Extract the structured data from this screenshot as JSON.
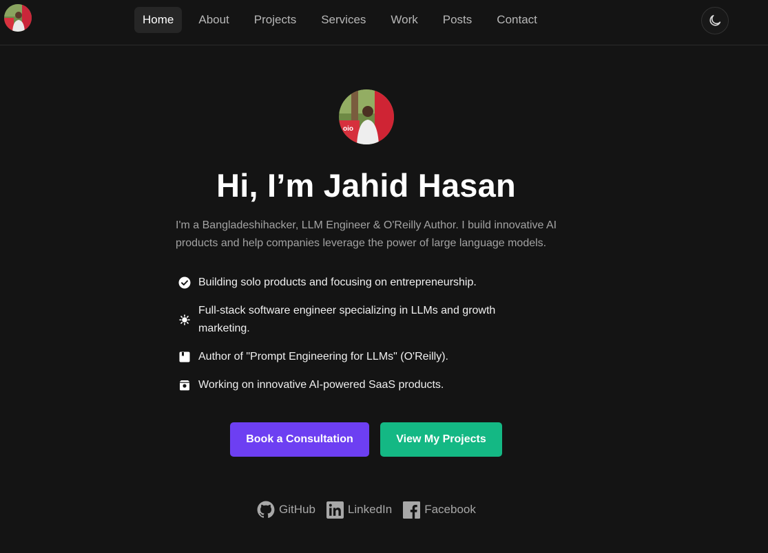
{
  "nav": {
    "items": [
      {
        "label": "Home",
        "active": true
      },
      {
        "label": "About"
      },
      {
        "label": "Projects"
      },
      {
        "label": "Services"
      },
      {
        "label": "Work"
      },
      {
        "label": "Posts"
      },
      {
        "label": "Contact"
      }
    ],
    "theme_toggle_icon": "moon-icon"
  },
  "hero": {
    "title": "Hi, I’m Jahid Hasan",
    "intro": "I'm a Bangladeshihacker, LLM Engineer & O'Reilly Author. I build innovative AI products and help companies leverage the power of large language models.",
    "highlights": [
      {
        "icon": "check-circle-icon",
        "text": "Building solo products and focusing on entrepreneurship."
      },
      {
        "icon": "sun-icon",
        "text": "Full-stack software engineer specializing in LLMs and growth marketing."
      },
      {
        "icon": "book-icon",
        "text": "Author of \"Prompt Engineering for LLMs\" (O'Reilly)."
      },
      {
        "icon": "product-box-icon",
        "text": "Working on innovative AI-powered SaaS products."
      }
    ],
    "primary_button": "Book a Consultation",
    "secondary_button": "View My Projects"
  },
  "socials": [
    {
      "icon": "github-icon",
      "label": "GitHub"
    },
    {
      "icon": "linkedin-icon",
      "label": "LinkedIn"
    },
    {
      "icon": "facebook-icon",
      "label": "Facebook"
    }
  ],
  "colors": {
    "background": "#141414",
    "primary_button": "#6d3ff2",
    "secondary_button": "#14b884"
  }
}
